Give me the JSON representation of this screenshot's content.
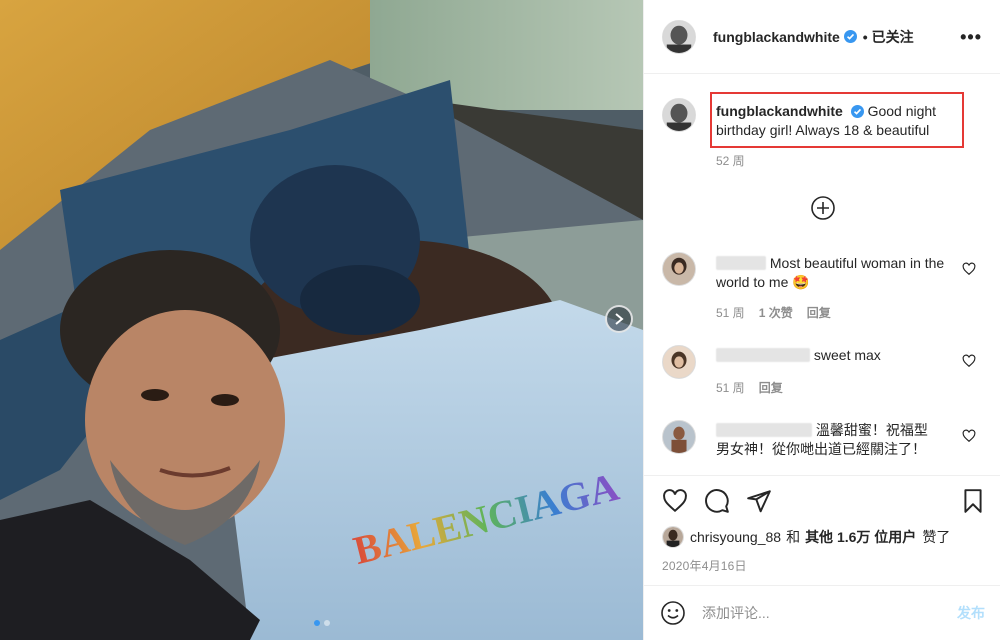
{
  "header": {
    "username": "fungblackandwhite",
    "follow_label": "• 已关注",
    "more_icon": "more-horizontal-icon",
    "verified_color": "#3897f0"
  },
  "caption": {
    "username": "fungblackandwhite",
    "text": "Good night birthday girl! Always 18 & beautiful",
    "time": "52 周",
    "highlight_color": "#e53935"
  },
  "load_more_icon": "plus-circle-icon",
  "comments": [
    {
      "text": "Most beautiful woman in the world to me 🤩",
      "time": "51 周",
      "likes": "1 次赞",
      "reply": "回复"
    },
    {
      "text": "sweet max",
      "time": "51 周",
      "reply": "回复"
    },
    {
      "text": "溫馨甜蜜！祝福型男女神！從你哋出道已經關注了！"
    }
  ],
  "actions": {
    "icons": [
      "heart-icon",
      "comment-icon",
      "share-icon",
      "bookmark-icon"
    ],
    "liked_by": "chrisyoung_88",
    "and": "和",
    "others": "其他 1.6万 位用户",
    "liked": "赞了",
    "date": "2020年4月16日"
  },
  "add_comment": {
    "placeholder": "添加评论...",
    "post_label": "发布"
  },
  "carousel": {
    "slides": 2,
    "active_index": 0,
    "active_dot_color": "#3897f0"
  },
  "photo": {
    "sweater_text": "BALENCIAGA"
  }
}
